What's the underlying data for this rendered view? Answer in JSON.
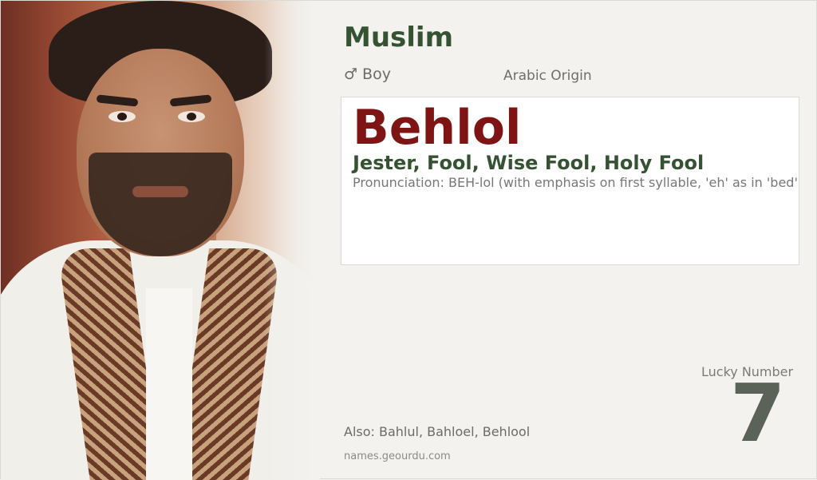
{
  "religion": "Muslim",
  "gender": {
    "symbol": "♂",
    "label": "Boy"
  },
  "origin": "Arabic Origin",
  "name": "Behlol",
  "meaning": "Jester, Fool, Wise Fool, Holy Fool",
  "pronunciation": "Pronunciation: BEH-lol (with emphasis on first syllable, 'eh' as in 'bed')",
  "lucky": {
    "label": "Lucky Number",
    "number": "7"
  },
  "also": "Also: Bahlul, Bahloel, Behlool",
  "site": "names.geourdu.com"
}
